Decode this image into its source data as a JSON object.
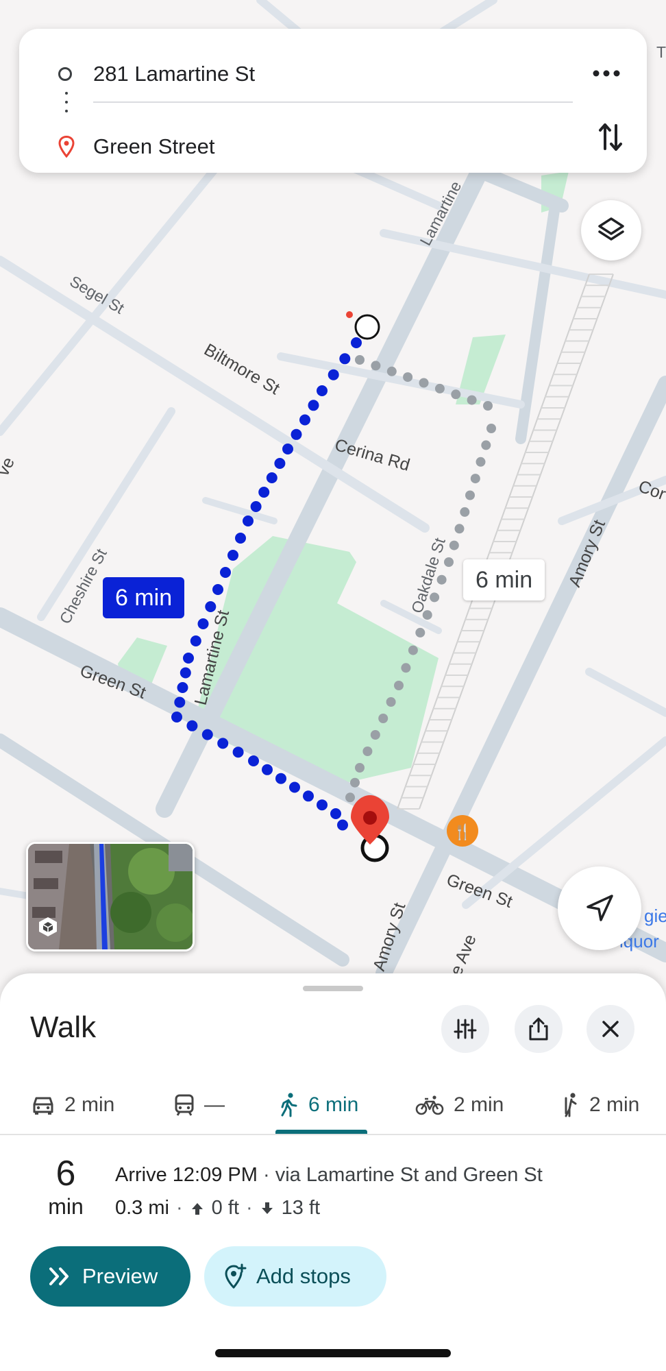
{
  "directions": {
    "origin": "281 Lamartine St",
    "destination": "Green Street"
  },
  "map": {
    "streets": {
      "lamartine_upper": "Lamartine",
      "segel": "Segel St",
      "biltmore": "Biltmore St",
      "cerina": "Cerina Rd",
      "cheshire": "Cheshire St",
      "lamartine": "Lamartine St",
      "oakdale": "Oakdale St",
      "amory_right": "Amory St",
      "green_left": "Green St",
      "green_right": "Green St",
      "amory_bottom": "Amory St",
      "ave_partial": "e Ave",
      "edge_left": "ve",
      "edge_right": "Cor",
      "edge_top": "T"
    },
    "place_partial": [
      "gie",
      "iquor"
    ],
    "primary_route_label": "6 min",
    "alt_route_label": "6 min",
    "colors": {
      "primary_route": "#0a22d6",
      "alt_route": "#9aa0a6",
      "park": "#c5ecd2",
      "road": "#cfd8e0",
      "pin": "#ea4335",
      "restaurant": "#f28b1e"
    }
  },
  "sheet": {
    "title": "Walk",
    "tabs": [
      {
        "icon": "car-icon",
        "label": "2 min"
      },
      {
        "icon": "transit-icon",
        "label": "—"
      },
      {
        "icon": "walk-icon",
        "label": "6 min"
      },
      {
        "icon": "bike-icon",
        "label": "2 min"
      },
      {
        "icon": "scooter-icon",
        "label": "2 min"
      }
    ],
    "eta_number": "6",
    "eta_unit": "min",
    "arrive_label": "Arrive 12:09 PM",
    "via": " · via Lamartine St and Green St",
    "distance": "0.3 mi",
    "ascent": "0 ft",
    "descent": "13 ft",
    "preview_label": "Preview",
    "add_stops_label": "Add stops"
  }
}
